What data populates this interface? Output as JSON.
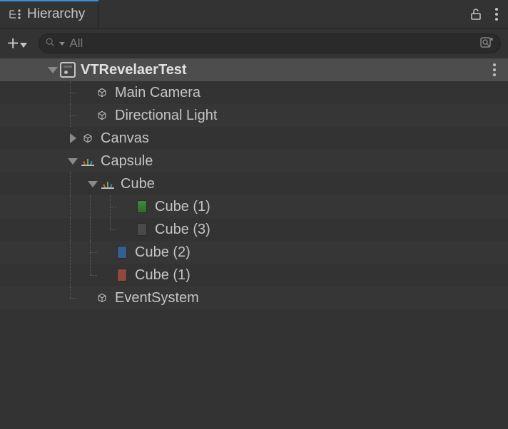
{
  "tab": {
    "title": "Hierarchy"
  },
  "search": {
    "placeholder": "All"
  },
  "tree": {
    "scene": {
      "name": "VTRevelaerTest"
    },
    "main_camera": "Main Camera",
    "directional_light": "Directional Light",
    "canvas": "Canvas",
    "capsule": "Capsule",
    "cube": "Cube",
    "cube_1a": "Cube (1)",
    "cube_3": "Cube (3)",
    "cube_2": "Cube (2)",
    "cube_1b": "Cube (1)",
    "event_system": "EventSystem"
  }
}
